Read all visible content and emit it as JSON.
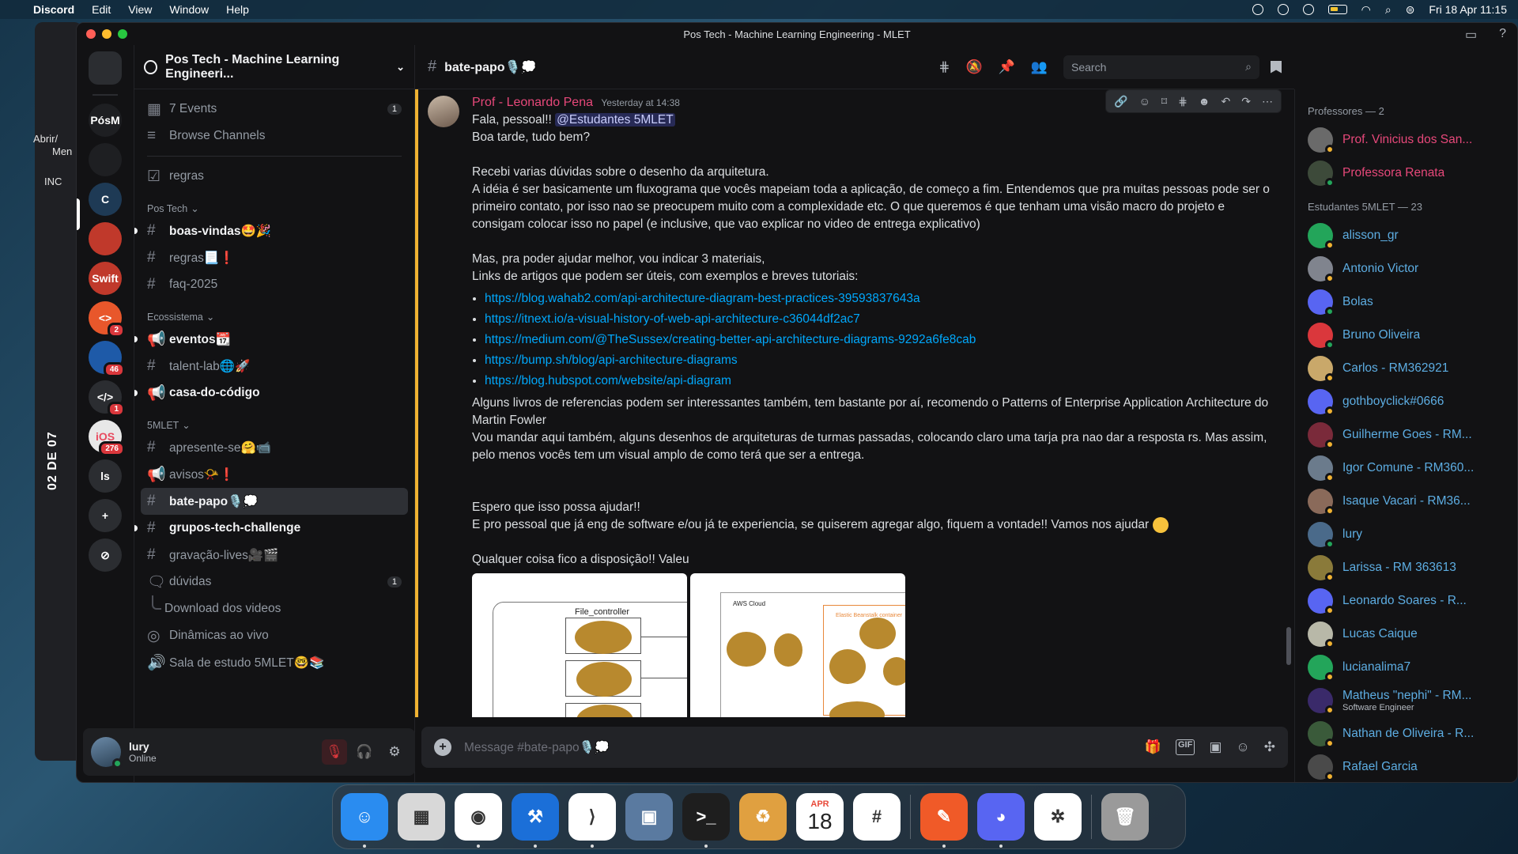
{
  "menubar": {
    "app_name": "Discord",
    "menus": [
      "Edit",
      "View",
      "Window",
      "Help"
    ],
    "datetime": "Fri 18 Apr  11:15"
  },
  "background": {
    "left_texts": [
      "Abrir/",
      "Men",
      "INC"
    ],
    "vertical_label": "02 DE 07"
  },
  "window": {
    "title": "Pos Tech - Machine Learning Engineering - MLET"
  },
  "rail": {
    "servers": [
      {
        "label": "",
        "icon": "discord-home-icon",
        "bg": "#2b2d31"
      },
      {
        "label": "PósM",
        "icon": "",
        "bg": "#1e1f22"
      },
      {
        "label": "",
        "icon": "server-icon",
        "bg": "#1e1f22"
      },
      {
        "label": "C",
        "icon": "",
        "bg": "#1e3a55"
      },
      {
        "label": "",
        "icon": "server-icon",
        "bg": "#c0392b"
      },
      {
        "label": "Swift",
        "icon": "",
        "bg": "#c0392b"
      },
      {
        "label": "<>",
        "icon": "",
        "bg": "#e8572b",
        "badge": "2"
      },
      {
        "label": "",
        "icon": "flutter-icon",
        "bg": "#1e5aa8",
        "badge": "46"
      },
      {
        "label": "</>",
        "icon": "",
        "bg": "#2b2d31",
        "badge": "1"
      },
      {
        "label": "iOS",
        "icon": "",
        "bg": "#e8e8e8",
        "badge": "276"
      },
      {
        "label": "ls",
        "icon": "",
        "bg": "#2b2d31"
      }
    ]
  },
  "sidebar": {
    "guild_name": "Pos Tech - Machine Learning Engineeri...",
    "top_items": [
      {
        "label": "7 Events",
        "icon": "calendar-icon",
        "count": "1"
      },
      {
        "label": "Browse Channels",
        "icon": "browse-icon"
      }
    ],
    "regras": "regras",
    "categories": [
      {
        "name": "Pos Tech",
        "channels": [
          {
            "label": "boas-vindas🤩🎉",
            "icon": "#",
            "unread": true
          },
          {
            "label": "regras📃❗",
            "icon": "#"
          },
          {
            "label": "faq-2025",
            "icon": "#"
          }
        ]
      },
      {
        "name": "Ecossistema",
        "channels": [
          {
            "label": "eventos📆",
            "icon": "📢",
            "unread": true
          },
          {
            "label": "talent-lab🌐🚀",
            "icon": "#"
          },
          {
            "label": "casa-do-código",
            "icon": "📢",
            "unread": true
          }
        ]
      },
      {
        "name": "5MLET",
        "channels": [
          {
            "label": "apresente-se🤗📹",
            "icon": "#"
          },
          {
            "label": "avisos📯❗",
            "icon": "📢"
          },
          {
            "label": "bate-papo🎙️💭",
            "icon": "#",
            "active": true
          },
          {
            "label": "grupos-tech-challenge",
            "icon": "#",
            "unread": true
          },
          {
            "label": "gravação-lives🎥🎬",
            "icon": "#"
          },
          {
            "label": "dúvidas",
            "icon": "forum",
            "count": "1"
          },
          {
            "label": "Download dos videos",
            "icon": "thread"
          },
          {
            "label": "Dinâmicas ao vivo",
            "icon": "stage"
          },
          {
            "label": "Sala de estudo 5MLET🤓📚",
            "icon": "voice"
          }
        ]
      }
    ]
  },
  "user": {
    "name": "lury",
    "status": "Online"
  },
  "chat": {
    "channel_name": "bate-papo🎙️💭",
    "search_placeholder": "Search",
    "composer_placeholder": "Message #bate-papo🎙️💭",
    "message": {
      "author": "Prof - Leonardo Pena",
      "author_color": "#e7487a",
      "time": "Yesterday at 14:38",
      "greeting": "Fala, pessoal!!",
      "mention": "@Estudantes 5MLET",
      "lines_a": [
        "Boa tarde, tudo bem?",
        "",
        "Recebi varias dúvidas sobre o desenho da arquitetura.",
        "A idéia é ser basicamente um fluxograma que vocês mapeiam toda a aplicação, de começo a fim. Entendemos que pra muitas pessoas pode ser o primeiro contato, por isso nao se preocupem muito com a complexidade etc. O que queremos é que tenham uma visão macro do projeto e consigam colocar isso no papel (e inclusive, que vao explicar no video de entrega explicativo)",
        "",
        "Mas, pra poder ajudar melhor, vou indicar 3 materiais,",
        "Links de artigos que podem ser úteis, com exemplos e breves tutoriais:"
      ],
      "links": [
        "https://blog.wahab2.com/api-architecture-diagram-best-practices-39593837643a",
        "https://itnext.io/a-visual-history-of-web-api-architecture-c36044df2ac7",
        "https://medium.com/@TheSussex/creating-better-api-architecture-diagrams-9292a6fe8cab",
        "https://bump.sh/blog/api-architecture-diagrams",
        "https://blog.hubspot.com/website/api-diagram"
      ],
      "lines_b": [
        "Alguns livros de referencias podem ser interessantes também, tem bastante por aí, recomendo o Patterns of Enterprise Application Architecture do Martin Fowler",
        "Vou mandar aqui também, alguns desenhos de arquiteturas de turmas passadas, colocando claro uma tarja pra nao dar a resposta rs. Mas assim, pelo menos vocês tem um visual amplo de como terá que ser a entrega.",
        "",
        "",
        "Espero que isso possa ajudar!!"
      ],
      "line_help": "E pro pessoal que já eng de software e/ou já te experiencia, se quiserem agregar algo, fiquem a vontade!! Vamos nos ajudar",
      "line_close": "Qualquer coisa fico a disposição!! Valeu",
      "attachment1_label": "File_controller",
      "attachment2_labels": [
        "AWS Cloud",
        "Elastic Beanstalk container"
      ]
    }
  },
  "members": {
    "groups": [
      {
        "title": "Professores — 2",
        "items": [
          {
            "name": "Prof. Vinicius dos San...",
            "color": "#e7487a",
            "avatar_bg": "#6a6a6a",
            "status": "#f0b232"
          },
          {
            "name": "Professora Renata",
            "color": "#e7487a",
            "avatar_bg": "#3d4a3a",
            "status": "#23a55a"
          }
        ]
      },
      {
        "title": "Estudantes 5MLET — 23",
        "items": [
          {
            "name": "alisson_gr",
            "color": "#5dade2",
            "avatar_bg": "#23a55a",
            "status": "#f0b232"
          },
          {
            "name": "Antonio Victor",
            "color": "#5dade2",
            "avatar_bg": "#80848e",
            "status": "#f0b232"
          },
          {
            "name": "Bolas",
            "color": "#5dade2",
            "avatar_bg": "#5865f2",
            "status": "#23a55a"
          },
          {
            "name": "Bruno Oliveira",
            "color": "#5dade2",
            "avatar_bg": "#da373c",
            "status": "#23a55a"
          },
          {
            "name": "Carlos - RM362921",
            "color": "#5dade2",
            "avatar_bg": "#c9a86a",
            "status": "#f0b232"
          },
          {
            "name": "gothboyclick#0666",
            "color": "#5dade2",
            "avatar_bg": "#5865f2",
            "status": "#f0b232"
          },
          {
            "name": "Guilherme Goes - RM...",
            "color": "#5dade2",
            "avatar_bg": "#7a2a3a",
            "status": "#f0b232"
          },
          {
            "name": "Igor Comune - RM360...",
            "color": "#5dade2",
            "avatar_bg": "#6b7b8c",
            "status": "#f0b232"
          },
          {
            "name": "Isaque Vacari - RM36...",
            "color": "#5dade2",
            "avatar_bg": "#8a6a5a",
            "status": "#f0b232"
          },
          {
            "name": "lury",
            "color": "#5dade2",
            "avatar_bg": "#4a6a8a",
            "status": "#23a55a"
          },
          {
            "name": "Larissa - RM 363613",
            "color": "#5dade2",
            "avatar_bg": "#8a7a3a",
            "status": "#f0b232"
          },
          {
            "name": "Leonardo Soares - R...",
            "color": "#5dade2",
            "avatar_bg": "#5865f2",
            "status": "#f0b232"
          },
          {
            "name": "Lucas Caique",
            "color": "#5dade2",
            "avatar_bg": "#b8b8a8",
            "status": "#f0b232"
          },
          {
            "name": "lucianalima7",
            "color": "#5dade2",
            "avatar_bg": "#23a55a",
            "status": "#f0b232"
          },
          {
            "name": "Matheus \"nephi\" - RM...",
            "color": "#5dade2",
            "avatar_bg": "#3a2a6a",
            "status": "#f0b232",
            "sub": "Software Engineer"
          },
          {
            "name": "Nathan de Oliveira - R...",
            "color": "#5dade2",
            "avatar_bg": "#3a5a3a",
            "status": "#f0b232"
          },
          {
            "name": "Rafael Garcia",
            "color": "#5dade2",
            "avatar_bg": "#4a4a4a",
            "status": "#f0b232"
          }
        ]
      }
    ]
  },
  "dock": {
    "calendar_month": "APR",
    "calendar_day": "18",
    "apps": [
      {
        "name": "finder",
        "bg": "#2a8cf0"
      },
      {
        "name": "launchpad",
        "bg": "#d8d8d8"
      },
      {
        "name": "chrome",
        "bg": "#ffffff"
      },
      {
        "name": "xcode",
        "bg": "#1b6fd8"
      },
      {
        "name": "vscode",
        "bg": "#ffffff"
      },
      {
        "name": "preview",
        "bg": "#5a7aa0"
      },
      {
        "name": "terminal",
        "bg": "#1e1e1e"
      },
      {
        "name": "recycle",
        "bg": "#e0a040"
      },
      {
        "name": "calendar",
        "bg": "#ffffff"
      },
      {
        "name": "slack",
        "bg": "#ffffff"
      },
      {
        "name": "pencil",
        "bg": "#f05a28"
      },
      {
        "name": "discord",
        "bg": "#5865f2"
      },
      {
        "name": "chatgpt",
        "bg": "#ffffff"
      },
      {
        "name": "trash",
        "bg": "#9a9a9a"
      }
    ]
  }
}
